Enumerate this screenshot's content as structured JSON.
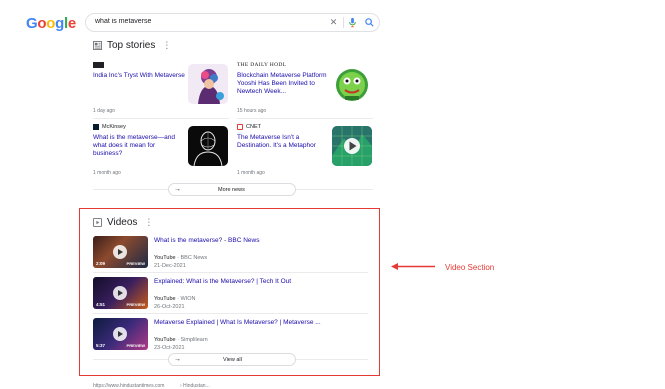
{
  "search": {
    "query": "what is metaverse",
    "logo_letters": [
      "G",
      "o",
      "o",
      "g",
      "l",
      "e"
    ]
  },
  "top_stories": {
    "title": "Top stories",
    "more_label": "More news",
    "cards": [
      {
        "source": "",
        "source_logo": "newspaper-masthead-icon",
        "headline": "India Inc's Tryst With Metaverse",
        "time": "1 day ago",
        "thumb": "avatar-illustration-thumbnail"
      },
      {
        "source": "THE DAILY HODL",
        "source_logo": "",
        "headline": "Blockchain Metaverse Platform Yooshi Has Been Invited to Newtech Week...",
        "time": "15 hours ago",
        "thumb": "green-mascot-thumbnail"
      },
      {
        "source": "McKinsey",
        "source_logo": "mckinsey-icon",
        "headline": "What is the metaverse—and what does it mean for business?",
        "time": "1 month ago",
        "thumb": "wireframe-person-thumbnail"
      },
      {
        "source": "CNET",
        "source_logo": "cnet-icon",
        "headline": "The Metaverse Isn't a Destination. It's a Metaphor",
        "time": "1 month ago",
        "thumb": "video-play-thumbnail"
      }
    ]
  },
  "videos": {
    "title": "Videos",
    "view_all_label": "View all",
    "items": [
      {
        "title": "What is the metaverse? - BBC News",
        "platform": "YouTube",
        "channel": "BBC News",
        "date": "21-Dec-2021",
        "duration": "2:09",
        "preview": "PREVIEW"
      },
      {
        "title": "Explained: What is the Metaverse? | Tech It Out",
        "platform": "YouTube",
        "channel": "WION",
        "date": "26-Oct-2021",
        "duration": "4:51",
        "preview": "PREVIEW"
      },
      {
        "title": "Metaverse Explained | What Is Metaverse? | Metaverse ...",
        "platform": "YouTube",
        "channel": "Simplilearn",
        "date": "23-Oct-2021",
        "duration": "5:37",
        "preview": "PREVIEW"
      }
    ]
  },
  "annotation": {
    "label": "Video Section",
    "color": "#e53935"
  },
  "colors": {
    "link": "#1a0dab",
    "muted": "#70757a",
    "border": "#dadce0"
  },
  "bottom_fragments": [
    "https://www.hindustantimes.com",
    "› Hindustan..."
  ]
}
